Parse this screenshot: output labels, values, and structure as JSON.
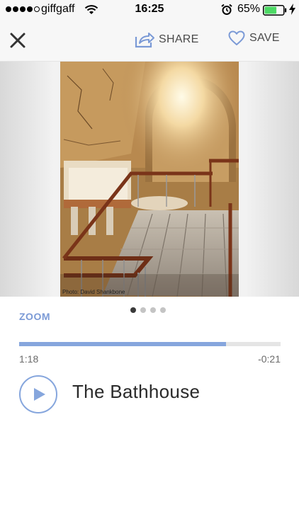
{
  "status_bar": {
    "carrier": "giffgaff",
    "time": "16:25",
    "battery_percent": "65%",
    "battery_level": 0.65,
    "signal_bars_filled": 4,
    "signal_bars_total": 5
  },
  "nav": {
    "share_label": "SHARE",
    "save_label": "SAVE",
    "icons": {
      "close": "close-icon",
      "share": "share-icon",
      "save": "heart-icon"
    },
    "accent_color": "#7b9ad6"
  },
  "photo": {
    "credit": "Photo: David Shankbone"
  },
  "gallery": {
    "zoom_label": "ZOOM",
    "page_count": 4,
    "active_page": 1
  },
  "player": {
    "elapsed": "1:18",
    "remaining": "-0:21",
    "progress": 0.79,
    "title": "The Bathhouse",
    "progress_color": "#86a6dd"
  }
}
